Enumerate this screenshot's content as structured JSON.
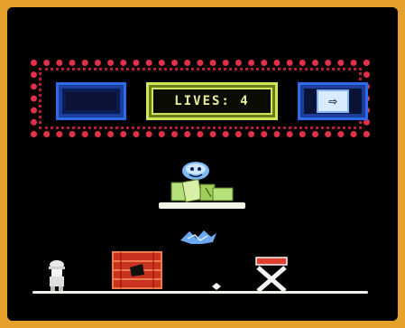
{
  "hud": {
    "lives_text": "LIVES: 4",
    "arrow_icon": "right-arrow-icon"
  },
  "colors": {
    "frame_red": "#e0304a",
    "panel_blue": "#2f6be8",
    "panel_yellow": "#cfe55a",
    "screen_bg": "#000000",
    "bezel": "#e6a12c"
  }
}
